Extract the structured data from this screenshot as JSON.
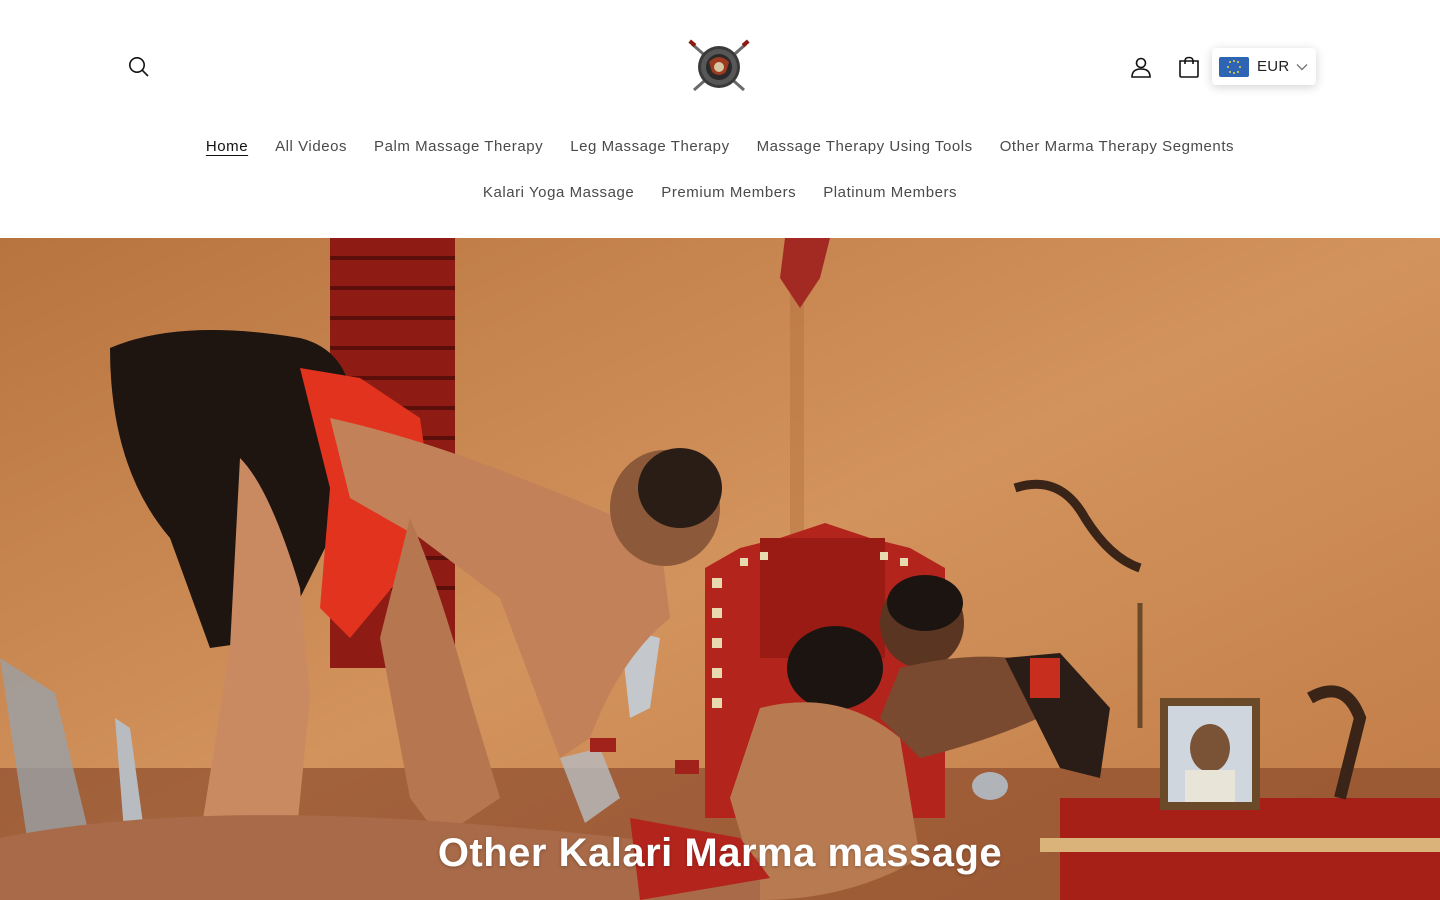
{
  "header": {
    "icons": {
      "search": "search-icon",
      "account": "user-icon",
      "cart": "shopping-bag-icon",
      "logo": "crossed-swords-logo"
    },
    "currency": {
      "code": "EUR",
      "flag": "eu-flag-icon"
    }
  },
  "nav": {
    "row1": [
      {
        "label": "Home",
        "active": true
      },
      {
        "label": "All Videos"
      },
      {
        "label": "Palm Massage Therapy"
      },
      {
        "label": "Leg Massage Therapy"
      },
      {
        "label": "Massage Therapy Using Tools"
      },
      {
        "label": "Other Marma Therapy Segments"
      }
    ],
    "row2": [
      {
        "label": "Kalari Yoga Massage"
      },
      {
        "label": "Premium Members"
      },
      {
        "label": "Platinum Members"
      }
    ]
  },
  "hero": {
    "title": "Other Kalari Marma massage"
  },
  "colors": {
    "nav_text": "#4a4a4a",
    "active_text": "#121212",
    "hero_wall": "#c98651",
    "hero_red": "#b3241c",
    "flag_blue": "#2e64b4"
  }
}
